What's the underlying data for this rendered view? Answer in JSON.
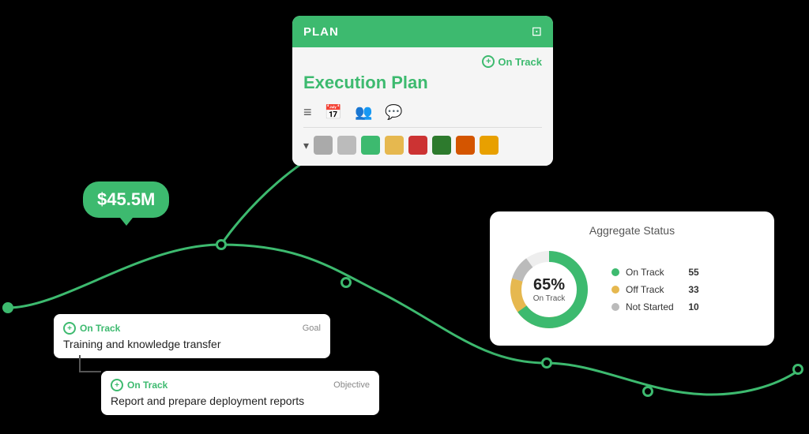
{
  "plan_card": {
    "header_title": "PLAN",
    "status": "On Track",
    "execution_title": "Execution Plan",
    "toolbar_icons": [
      "list-icon",
      "calendar-icon",
      "people-icon",
      "chat-icon"
    ],
    "colors": [
      "#aaa",
      "#aaa",
      "#3dba6f",
      "#e6b84f",
      "#cc3333",
      "#2d7a2d",
      "#d45500",
      "#e8a000"
    ]
  },
  "money_bubble": {
    "value": "$45.5M"
  },
  "goal_card": {
    "status": "On Track",
    "type_label": "Goal",
    "text": "Training and knowledge transfer"
  },
  "objective_card": {
    "status": "On Track",
    "type_label": "Objective",
    "text": "Report and prepare deployment reports"
  },
  "aggregate_card": {
    "title": "Aggregate Status",
    "percent": "65%",
    "percent_label": "On Track",
    "legend": [
      {
        "label": "On Track",
        "count": "55",
        "color": "#3dba6f"
      },
      {
        "label": "Off Track",
        "count": "33",
        "color": "#e6b84f"
      },
      {
        "label": "Not Started",
        "count": "10",
        "color": "#bbb"
      }
    ]
  },
  "icons": {
    "edit": "⊠",
    "plus_circle": "⊕",
    "on_track_plus": "+"
  }
}
